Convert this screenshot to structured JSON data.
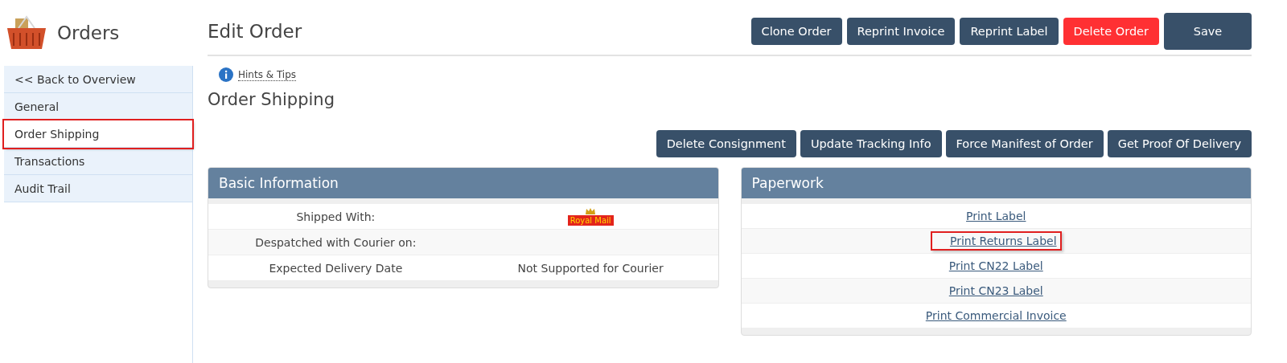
{
  "app": {
    "title": "Orders"
  },
  "sidebar": {
    "items": [
      {
        "label": "<< Back to Overview",
        "selected": false,
        "highlighted": false
      },
      {
        "label": "General",
        "selected": false,
        "highlighted": false
      },
      {
        "label": "Order Shipping",
        "selected": true,
        "highlighted": true
      },
      {
        "label": "Transactions",
        "selected": false,
        "highlighted": false
      },
      {
        "label": "Audit Trail",
        "selected": false,
        "highlighted": false
      }
    ]
  },
  "page": {
    "title": "Edit Order"
  },
  "header_buttons": [
    {
      "label": "Clone Order",
      "kind": "normal"
    },
    {
      "label": "Reprint Invoice",
      "kind": "normal"
    },
    {
      "label": "Reprint Label",
      "kind": "normal"
    },
    {
      "label": "Delete Order",
      "kind": "danger"
    },
    {
      "label": "Save",
      "kind": "primary"
    }
  ],
  "hints": {
    "label": "Hints & Tips"
  },
  "section": {
    "title": "Order Shipping"
  },
  "action_buttons": [
    "Delete Consignment",
    "Update Tracking Info",
    "Force Manifest of Order",
    "Get Proof Of Delivery"
  ],
  "basic_information": {
    "title": "Basic Information",
    "rows": [
      {
        "label": "Shipped With:",
        "kind": "logo",
        "value": "Royal Mail"
      },
      {
        "label": "Despatched with Courier on:",
        "kind": "text",
        "value": ""
      },
      {
        "label": "Expected Delivery Date",
        "kind": "text",
        "value": "Not Supported for Courier"
      }
    ]
  },
  "paperwork": {
    "title": "Paperwork",
    "links": [
      {
        "label": "Print Label",
        "highlighted": false
      },
      {
        "label": "Print Returns Label",
        "highlighted": true
      },
      {
        "label": "Print CN22 Label",
        "highlighted": false
      },
      {
        "label": "Print CN23 Label",
        "highlighted": false
      },
      {
        "label": "Print Commercial Invoice",
        "highlighted": false
      }
    ]
  }
}
